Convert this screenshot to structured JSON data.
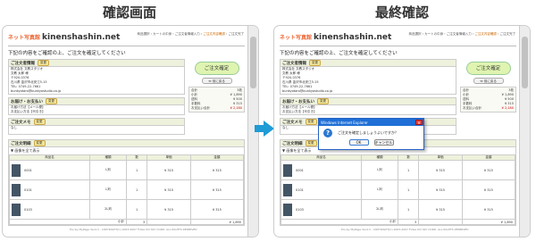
{
  "titles": {
    "left": "確認画面",
    "right": "最終確認"
  },
  "site": {
    "logo": "ネット写真館",
    "name": "kinenshashin.net"
  },
  "nav": {
    "steps": [
      "商品選択",
      "カートの中身",
      "ご注文者情報入力",
      "ご注文内容確認",
      "ご注文完了"
    ],
    "current_index": 3,
    "current_label": "ご注文内容確認"
  },
  "instruction": "下記の内容をご確認の上、ご注文を確定してください",
  "orderer": {
    "header": "ご注文者情報",
    "change_label": "変更",
    "lines": [
      "株式会社 文教スタジオ",
      "文教 太郎 様",
      "〒920-0376",
      "石川県 金沢市北安江5-15",
      "TEL: 0749-22-7661",
      "bunkyotaro@bunkyostudio.co.jp"
    ]
  },
  "payment": {
    "header": "お届け・お支払い",
    "change_label": "変更",
    "lines": [
      "お届け方法【メール便】",
      "お支払い方法【代引き】"
    ]
  },
  "memo": {
    "header": "ご注文メモ",
    "change_label": "変更",
    "text": "なし"
  },
  "items": {
    "header": "ご注文明細",
    "change_label": "変更",
    "toggle_label": "▼ 画像を全て表示",
    "columns": [
      "商品名",
      "種類",
      "数",
      "単価",
      "金額"
    ],
    "rows": [
      {
        "name": "0001",
        "type": "L判",
        "qty": "1",
        "unit": "¥ 315",
        "amount": "¥ 315"
      },
      {
        "name": "0101",
        "type": "L判",
        "qty": "1",
        "unit": "¥ 315",
        "amount": "¥ 315"
      },
      {
        "name": "0103",
        "type": "2L判",
        "qty": "1",
        "unit": "¥ 315",
        "amount": "¥ 315"
      }
    ],
    "subtotal_label": "小計",
    "subtotal_qty": "3",
    "subtotal_amount": "¥ 1,890"
  },
  "confirm_button": "ご注文確定",
  "back_button": "≪ 前に戻る",
  "summary": {
    "rows": [
      {
        "label": "合計",
        "value": "3枚"
      },
      {
        "label": "小計",
        "value": "¥ 1,890"
      },
      {
        "label": "送料",
        "value": "¥ 500"
      },
      {
        "label": "手数料",
        "value": "¥ 315"
      },
      {
        "label": "お支払い合計",
        "value": "¥ 2,180"
      }
    ]
  },
  "dialog": {
    "title": "Windows Internet Explorer",
    "message": "ご注文を確定しましょうよいですか？",
    "ok": "OK",
    "cancel": "キャンセル"
  },
  "copyright": "Pro-by MyPage Ver4.3 - COPYRIGHT(C) 2003-2007 FUGA DO SKY CORP., ALL RIGHTS RESERVED",
  "colors": {
    "accent": "#1f9bd6",
    "section_header": "#eef2dc",
    "confirm_button": "#dff4b0",
    "dialog_title": "#1f6fd6"
  }
}
